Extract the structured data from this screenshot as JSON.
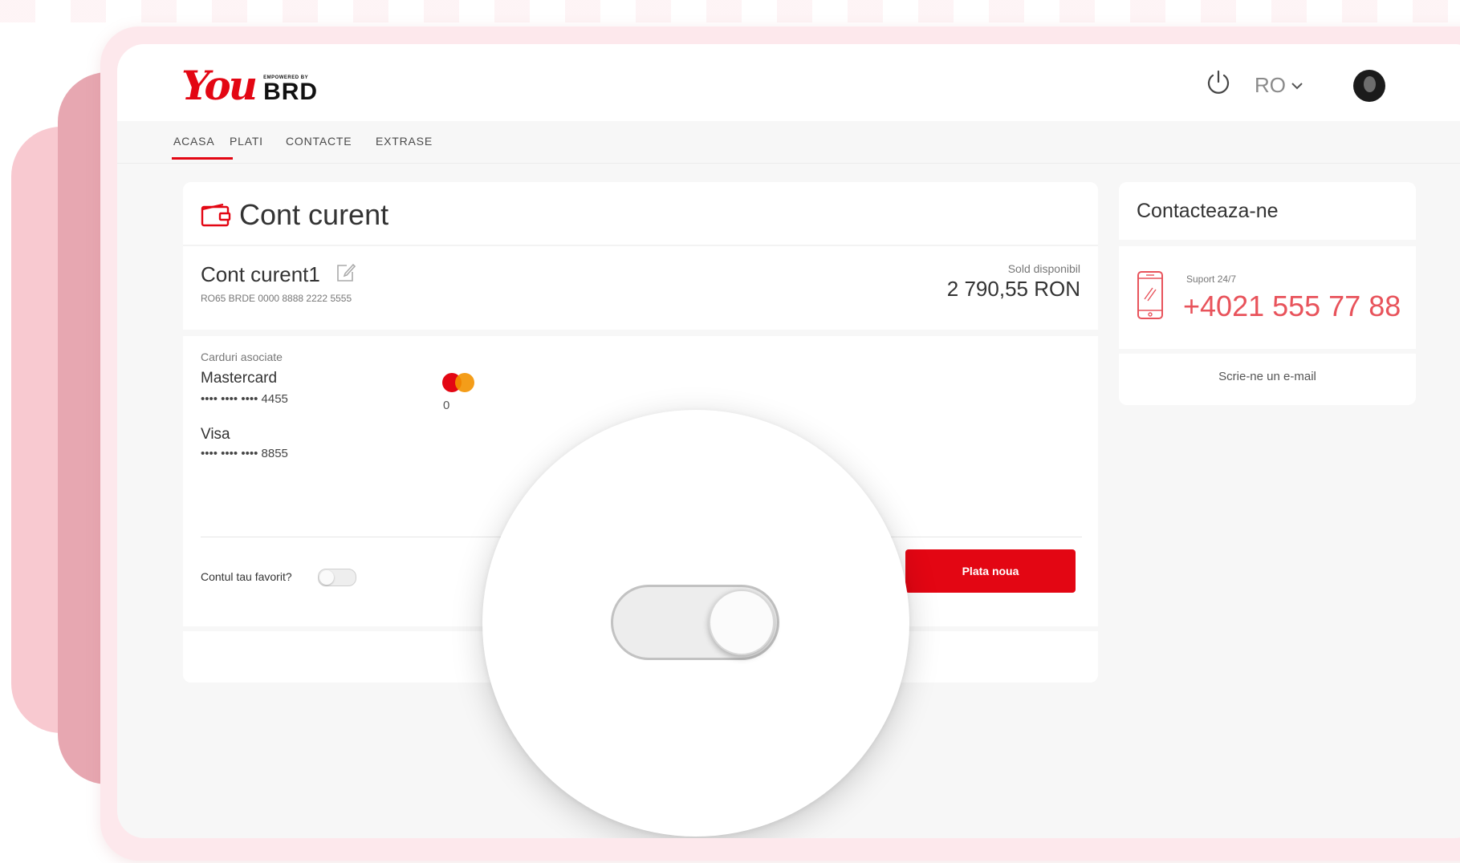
{
  "brand": {
    "logo_you": "You",
    "logo_powered": "EMPOWERED BY",
    "logo_brd": "BRD"
  },
  "header": {
    "language": "RO",
    "icons": [
      "power-icon",
      "chevron-down-icon",
      "avatar"
    ]
  },
  "nav": {
    "items": [
      {
        "label": "ACASA",
        "active": true
      },
      {
        "label": "PLATI",
        "active": false
      },
      {
        "label": "CONTACTE",
        "active": false
      },
      {
        "label": "EXTRASE",
        "active": false
      }
    ]
  },
  "account_card": {
    "title": "Cont curent",
    "account_name": "Cont curent1",
    "iban": "RO65 BRDE 0000 8888 2222 5555",
    "balance_label": "Sold disponibil",
    "balance_value": "2 790,55 RON",
    "cards_label": "Carduri asociate",
    "cards": [
      {
        "name": "Mastercard",
        "number": "•••• •••• •••• 4455"
      },
      {
        "name": "Visa",
        "number": "•••• •••• ••••  8855"
      }
    ],
    "card_expiry_partial": "0",
    "favorite_label": "Contul tau favorit?",
    "favorite_on": false,
    "new_payment_label": "Plata noua"
  },
  "contact_card": {
    "title": "Contacteaza-ne",
    "support_label": "Suport 24/7",
    "phone": "+4021 555 77 88",
    "email_link": "Scrie-ne un e-mail"
  },
  "magnified_toggle": {
    "state": "on"
  },
  "colors": {
    "accent": "#e30613",
    "phone": "#e8535b",
    "deco_light": "#f8c9d0",
    "deco_dark": "#e7a7b1"
  }
}
